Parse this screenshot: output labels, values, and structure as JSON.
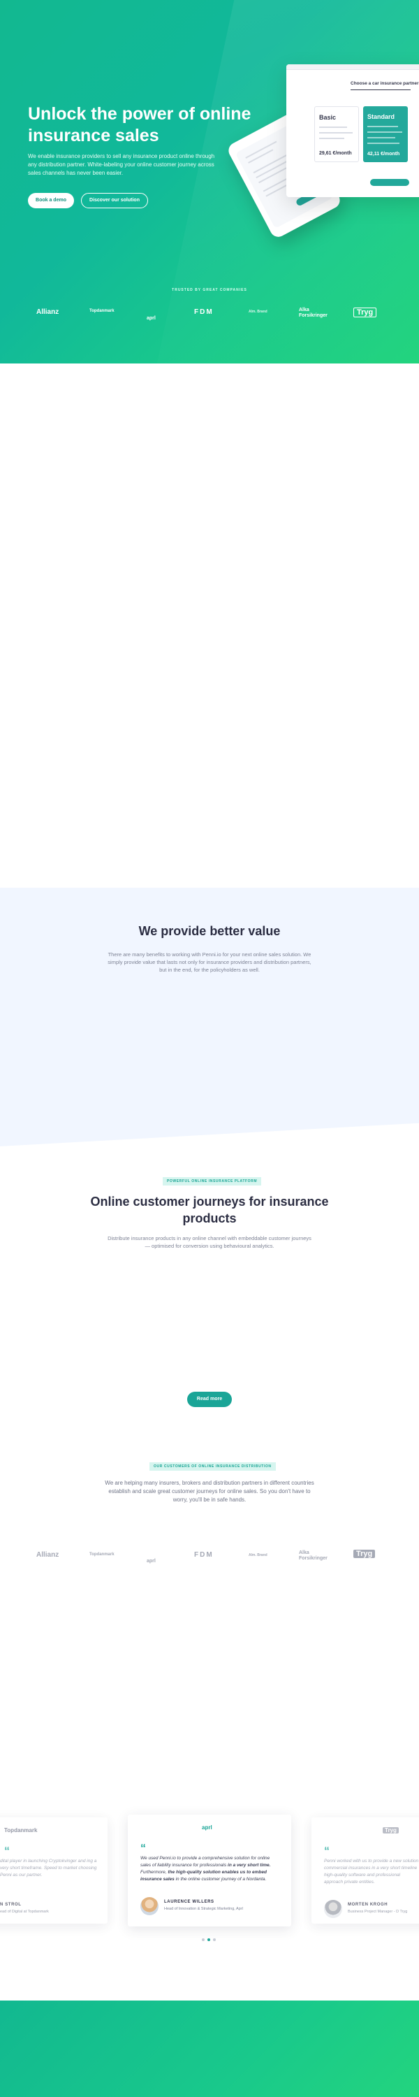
{
  "hero": {
    "title": "Unlock the power of online insurance sales",
    "subtitle": "We enable insurance providers to sell any insurance product online through any distribution partner. White-labeling your online customer journey across sales channels has never been easier.",
    "book_demo_label": "Book a demo",
    "discover_label": "Discover our solution",
    "trusted_label": "TRUSTED BY GREAT COMPANIES",
    "logos": [
      "Allianz",
      "Topdanmark",
      "aprl",
      "FDM",
      "Alm. Brand",
      "Alka Forsikringer",
      "Tryg"
    ]
  },
  "mockup": {
    "laptop_title": "Choose a car insurance partner",
    "plan_basic": "Basic",
    "plan_standard": "Standard",
    "price_basic": "29,61 €/month",
    "price_standard": "42,11 €/month"
  },
  "value_section": {
    "title": "We provide better value",
    "text": "There are many benefits to working with Penni.io for your next online sales solution. We simply provide value that lasts not only for insurance providers and distribution partners, but in the end, for the policyholders as well."
  },
  "journeys": {
    "tag": "POWERFUL ONLINE INSURANCE PLATFORM",
    "title": "Online customer journeys for insurance products",
    "text": "Distribute insurance products in any online channel with embeddable customer journeys — optimised for conversion using behavioural analytics.",
    "read_more_label": "Read more"
  },
  "customers": {
    "tag": "OUR CUSTOMERS OF ONLINE INSURANCE DISTRIBUTION",
    "text": "We are helping many insurers, brokers and distribution partners in different countries establish and scale great customer journeys for online sales. So you don't have to worry, you'll be in safe hands."
  },
  "testimonials": {
    "left": {
      "company": "Topdanmark",
      "quote": "dital player in launching Cryptokvinger and ing a very short timeframe. Speed to market choosing Penni as our partner.",
      "name": "N STROL",
      "role": "ead of Digital at Topdanmark"
    },
    "center": {
      "company": "aprl",
      "quote_intro": "We used Penni.io to provide a comprehensive solution for online sales of liability insurance for professionals",
      "quote_bold_1": "in a very short time.",
      "quote_middle": "Furthermore,",
      "quote_bold_2": "the high-quality solution enables us to embed insurance sales",
      "quote_end": "in the online customer journey of a Nordanta.",
      "name": "LAURENCE WILLERS",
      "role": "Head of Innovation & Strategic Marketing, Aprl"
    },
    "right": {
      "company": "Tryg",
      "quote": "Penni worked with us to provide a new solution commercial insurances in a very short timeline high-quality software and professional approach private entities.",
      "name": "MORTEN KROGH",
      "role": "Business Project Manager - D Tryg"
    }
  },
  "colors": {
    "brand_green": "#12b890",
    "accent_teal": "#1aa597",
    "light_bg": "#f1f6ff"
  }
}
